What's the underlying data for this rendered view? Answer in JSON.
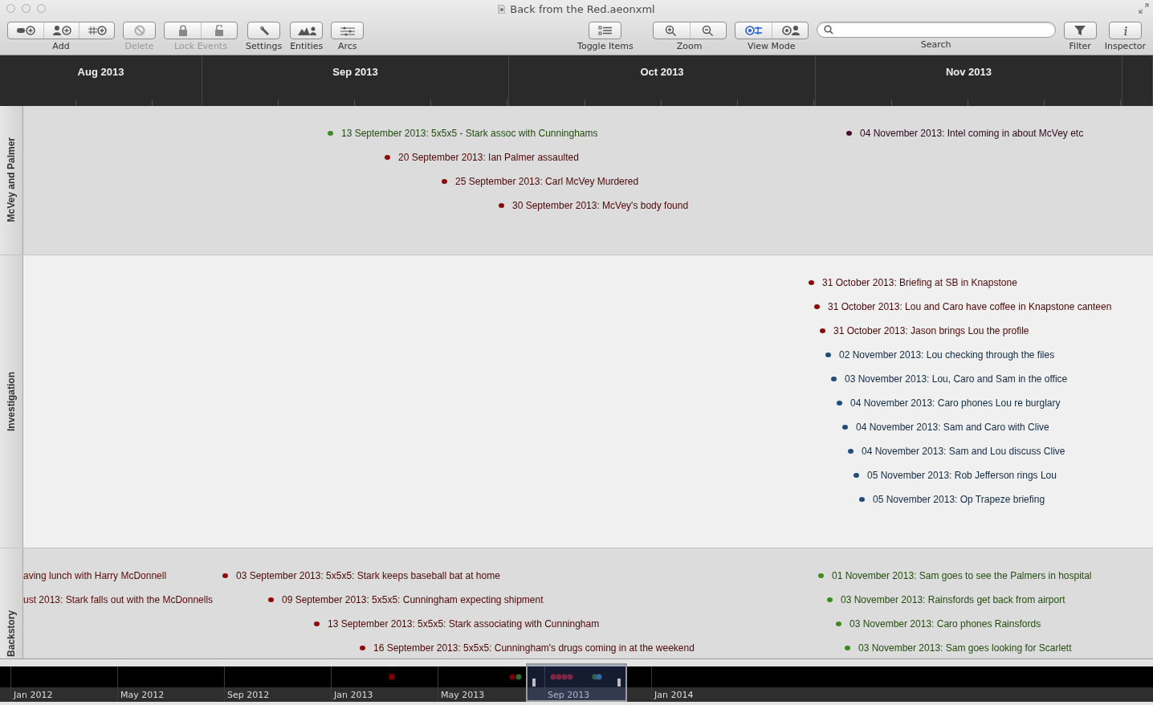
{
  "window": {
    "title": "Back from the Red.aeonxml"
  },
  "toolbar": {
    "left": [
      {
        "label": "Add",
        "kind": "segmented",
        "disabled": false
      },
      {
        "label": "Delete",
        "kind": "button",
        "disabled": true
      },
      {
        "label": "Lock Events",
        "kind": "segmented",
        "disabled": true
      },
      {
        "label": "Settings",
        "kind": "button",
        "disabled": false
      },
      {
        "label": "Entities",
        "kind": "button",
        "disabled": false
      },
      {
        "label": "Arcs",
        "kind": "button",
        "disabled": false
      }
    ],
    "right": [
      {
        "label": "Toggle Items",
        "kind": "button",
        "disabled": false
      },
      {
        "label": "Zoom",
        "kind": "segmented",
        "disabled": false
      },
      {
        "label": "View Mode",
        "kind": "segmented",
        "disabled": false,
        "segments": [
          {
            "selected": true
          },
          {
            "selected": false
          }
        ]
      },
      {
        "label": "Search",
        "kind": "search",
        "disabled": false
      },
      {
        "label": "Filter",
        "kind": "button",
        "disabled": false
      },
      {
        "label": "Inspector",
        "kind": "button",
        "disabled": false
      }
    ]
  },
  "months": [
    "Aug 2013",
    "Sep 2013",
    "Oct 2013",
    "Nov 2013"
  ],
  "lanes": [
    {
      "name": "McVey and Palmer",
      "middle_events": [
        {
          "label": "13 September 2013: 5x5x5 - Stark assoc with Cunninghams",
          "color": "#3d8c1c"
        },
        {
          "label": "20 September 2013: Ian Palmer assaulted",
          "color": "#8c0a0a"
        },
        {
          "label": "25 September 2013: Carl McVey Murdered",
          "color": "#8c0a0a"
        },
        {
          "label": "30 September 2013: McVey's body found",
          "color": "#8c0a0a"
        }
      ],
      "right_events": [
        {
          "label": "04 November 2013: Intel coming in about McVey etc",
          "color": "#4a0f2e"
        }
      ]
    },
    {
      "name": "Investigation",
      "right_events": [
        {
          "label": "31 October 2013: Briefing at SB in Knapstone",
          "color": "#8c0a0a"
        },
        {
          "label": "31 October 2013: Lou and Caro have coffee in Knapstone canteen",
          "color": "#8c0a0a"
        },
        {
          "label": "31 October 2013: Jason brings Lou the profile",
          "color": "#8c0a0a"
        },
        {
          "label": "02 November 2013: Lou checking through the files",
          "color": "#1f4d7a"
        },
        {
          "label": "03 November 2013: Lou, Caro and Sam in the office",
          "color": "#1f4d7a"
        },
        {
          "label": "04 November 2013: Caro phones Lou re burglary",
          "color": "#1f4d7a"
        },
        {
          "label": "04 November 2013: Sam and Caro with Clive",
          "color": "#1f4d7a"
        },
        {
          "label": "04 November 2013: Sam and Lou discuss Clive",
          "color": "#1f4d7a"
        },
        {
          "label": "05 November 2013: Rob Jefferson rings Lou",
          "color": "#1f4d7a"
        },
        {
          "label": "05 November 2013: Op Trapeze briefing",
          "color": "#1f4d7a"
        }
      ]
    },
    {
      "name": "Backstory",
      "left_events": [
        {
          "label": "aving lunch with Harry McDonnell"
        },
        {
          "label": "ust 2013: Stark falls out with the McDonnells"
        }
      ],
      "middle_events": [
        {
          "label": "03 September 2013: 5x5x5: Stark keeps baseball bat at home",
          "color": "#8c0a0a"
        },
        {
          "label": "09 September 2013: 5x5x5: Cunningham expecting shipment",
          "color": "#8c0a0a"
        },
        {
          "label": "13 September 2013: 5x5x5: Stark associating with Cunningham",
          "color": "#8c0a0a"
        },
        {
          "label": "16 September 2013: 5x5x5: Cunningham's drugs coming in at the weekend",
          "color": "#8c0a0a"
        }
      ],
      "right_events": [
        {
          "label": "01 November 2013: Sam goes to see the Palmers in hospital",
          "color": "#3d8c1c"
        },
        {
          "label": "03 November 2013: Rainsfords get back from airport",
          "color": "#3d8c1c"
        },
        {
          "label": "03 November 2013: Caro phones Rainsfords",
          "color": "#3d8c1c"
        },
        {
          "label": "03 November 2013: Sam goes looking for Scarlett",
          "color": "#3d8c1c"
        }
      ]
    }
  ],
  "overview": {
    "labels": [
      {
        "label": "Jan 2012",
        "selected": false
      },
      {
        "label": "May 2012",
        "selected": false
      },
      {
        "label": "Sep 2012",
        "selected": false
      },
      {
        "label": "Jan 2013",
        "selected": false
      },
      {
        "label": "May 2013",
        "selected": false
      },
      {
        "label": "Sep 2013",
        "selected": true
      },
      {
        "label": "Jan 2014",
        "selected": false
      }
    ]
  }
}
